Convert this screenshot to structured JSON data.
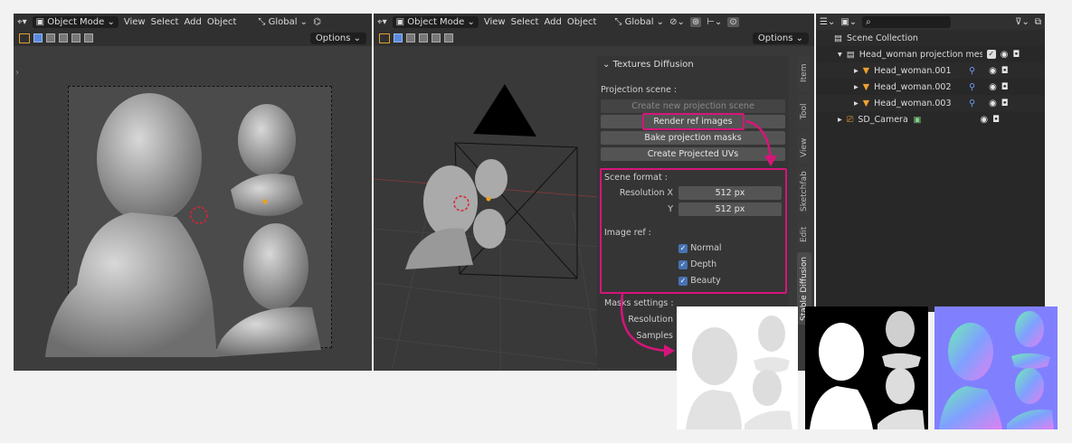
{
  "viewport_left": {
    "header": {
      "mode_label": "Object Mode",
      "menus": [
        "View",
        "Select",
        "Add",
        "Object"
      ],
      "transform_label": "Global"
    },
    "options_label": "Options"
  },
  "viewport_mid": {
    "header": {
      "mode_label": "Object Mode",
      "menus": [
        "View",
        "Select",
        "Add",
        "Object"
      ],
      "transform_label": "Global"
    },
    "options_label": "Options"
  },
  "textures_panel": {
    "title": "Textures Diffusion",
    "projection_scene_label": "Projection scene :",
    "create_btn": "Create new projection scene",
    "render_btn": "Render ref images",
    "bake_btn": "Bake projection masks",
    "create_uv_btn": "Create Projected UVs",
    "scene_format_label": "Scene format :",
    "res_x_label": "Resolution X",
    "res_x_value": "512 px",
    "res_y_label": "Y",
    "res_y_value": "512 px",
    "image_ref_label": "Image ref :",
    "checks": [
      "Normal",
      "Depth",
      "Beauty"
    ],
    "masks_label": "Masks settings :",
    "masks_res_label": "Resolution",
    "masks_samples_label": "Samples"
  },
  "side_tabs": [
    "Item",
    "Tool",
    "View",
    "Sketchfab",
    "Edit",
    "Stable Diffusion"
  ],
  "outliner": {
    "collection": "Scene Collection",
    "items": [
      {
        "name": "Head_woman projection mesh"
      },
      {
        "name": "Head_woman.001"
      },
      {
        "name": "Head_woman.002"
      },
      {
        "name": "Head_woman.003"
      },
      {
        "name": "SD_Camera"
      }
    ]
  },
  "colors": {
    "highlight": "#d6157a",
    "accent": "#4772b3"
  }
}
